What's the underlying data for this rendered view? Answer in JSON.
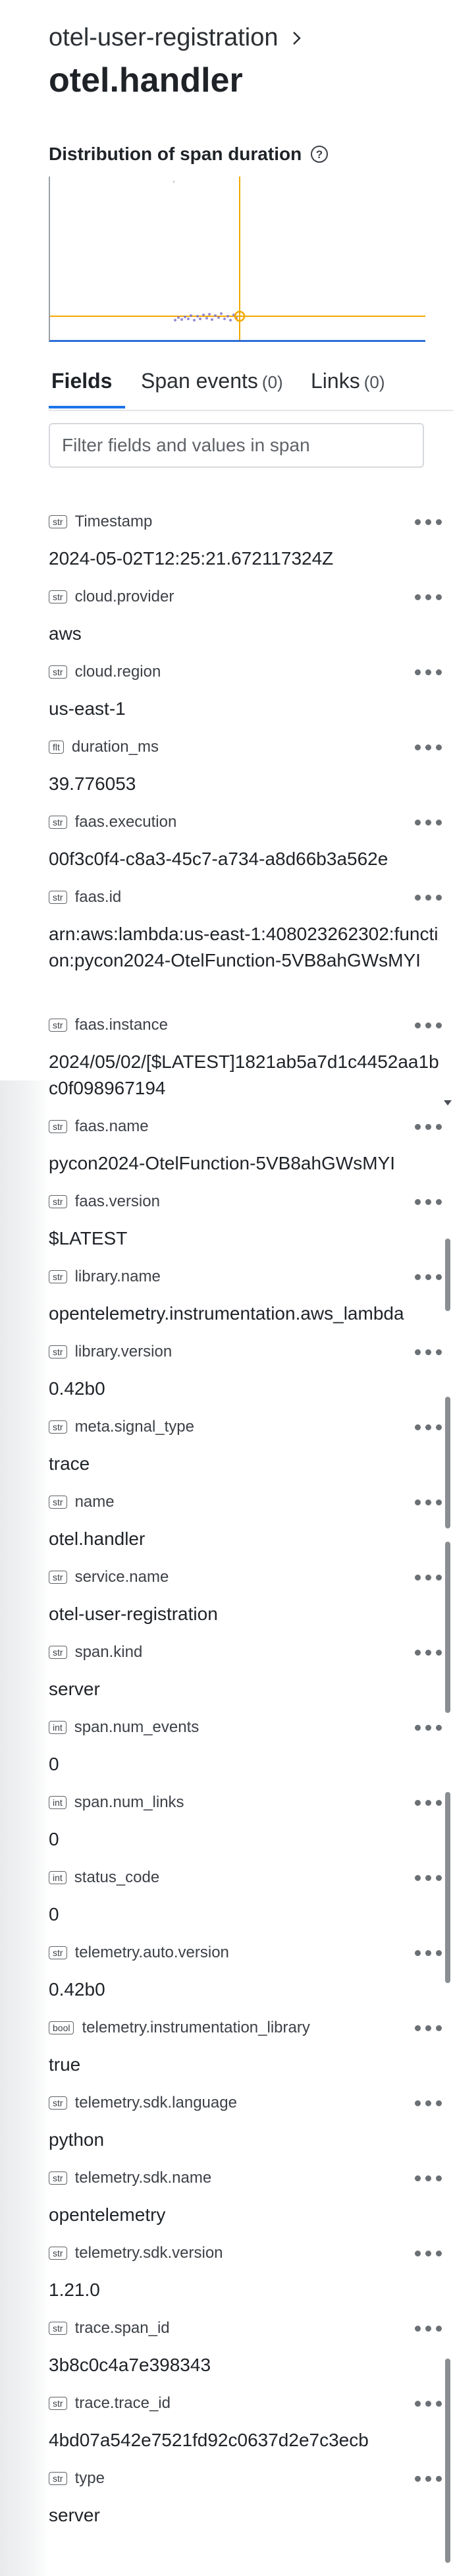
{
  "header": {
    "breadcrumb": "otel-user-registration",
    "span_name": "otel.handler"
  },
  "distribution": {
    "title": "Distribution of span duration",
    "highlight_color": "#f2a900",
    "marker_color": "#f2a900",
    "axis_color": "#2f6fd6"
  },
  "tabs": [
    {
      "label": "Fields",
      "count": ""
    },
    {
      "label": "Span events",
      "count": "(0)"
    },
    {
      "label": "Links",
      "count": "(0)"
    }
  ],
  "filter": {
    "placeholder": "Filter fields and values in span",
    "value": ""
  },
  "fields": [
    {
      "type": "str",
      "name": "Timestamp",
      "value": "2024-05-02T12:25:21.672117324Z"
    },
    {
      "type": "str",
      "name": "cloud.provider",
      "value": "aws"
    },
    {
      "type": "str",
      "name": "cloud.region",
      "value": "us-east-1"
    },
    {
      "type": "flt",
      "name": "duration_ms",
      "value": "39.776053"
    },
    {
      "type": "str",
      "name": "faas.execution",
      "value": "00f3c0f4-c8a3-45c7-a734-a8d66b3a562e"
    },
    {
      "type": "str",
      "name": "faas.id",
      "value": "arn:aws:lambda:us-east-1:408023262302:function:pycon2024-OtelFunction-5VB8ahGWsMYI"
    },
    {
      "type": "str",
      "name": "faas.instance",
      "value": "2024/05/02/[$LATEST]1821ab5a7d1c4452aa1bc0f098967194"
    },
    {
      "type": "str",
      "name": "faas.name",
      "value": "pycon2024-OtelFunction-5VB8ahGWsMYI"
    },
    {
      "type": "str",
      "name": "faas.version",
      "value": "$LATEST"
    },
    {
      "type": "str",
      "name": "library.name",
      "value": "opentelemetry.instrumentation.aws_lambda"
    },
    {
      "type": "str",
      "name": "library.version",
      "value": "0.42b0"
    },
    {
      "type": "str",
      "name": "meta.signal_type",
      "value": "trace"
    },
    {
      "type": "str",
      "name": "name",
      "value": "otel.handler"
    },
    {
      "type": "str",
      "name": "service.name",
      "value": "otel-user-registration"
    },
    {
      "type": "str",
      "name": "span.kind",
      "value": "server"
    },
    {
      "type": "int",
      "name": "span.num_events",
      "value": "0"
    },
    {
      "type": "int",
      "name": "span.num_links",
      "value": "0"
    },
    {
      "type": "int",
      "name": "status_code",
      "value": "0"
    },
    {
      "type": "str",
      "name": "telemetry.auto.version",
      "value": "0.42b0"
    },
    {
      "type": "bool",
      "name": "telemetry.instrumentation_library",
      "value": "true"
    },
    {
      "type": "str",
      "name": "telemetry.sdk.language",
      "value": "python"
    },
    {
      "type": "str",
      "name": "telemetry.sdk.name",
      "value": "opentelemetry"
    },
    {
      "type": "str",
      "name": "telemetry.sdk.version",
      "value": "1.21.0"
    },
    {
      "type": "str",
      "name": "trace.span_id",
      "value": "3b8c0c4a7e398343"
    },
    {
      "type": "str",
      "name": "trace.trace_id",
      "value": "4bd07a542e7521fd92c0637d2e7c3ecb"
    },
    {
      "type": "str",
      "name": "type",
      "value": "server"
    }
  ]
}
